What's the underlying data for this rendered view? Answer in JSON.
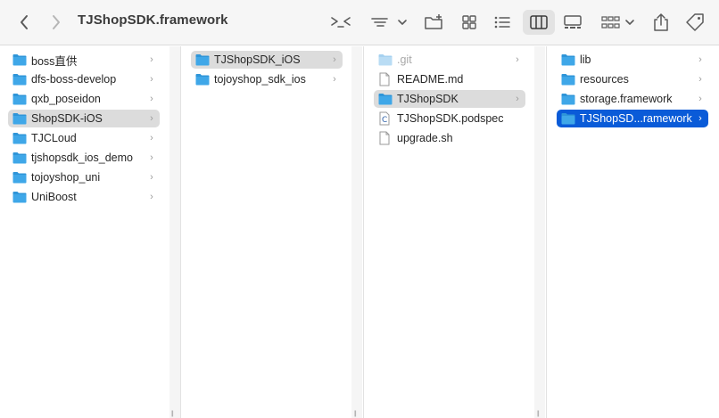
{
  "window": {
    "title": "TJShopSDK.framework",
    "accent_color": "#0a5bd8",
    "folder_color": "#3fa7e8"
  },
  "toolbar": {
    "back_icon": "chevron-left-icon",
    "forward_icon": "chevron-right-icon",
    "terminal_icon": "terminal-icon",
    "group_icon": "group-list-icon",
    "new_folder_icon": "new-folder-icon",
    "view_modes": [
      "icon-view-icon",
      "list-view-icon",
      "column-view-icon",
      "gallery-view-icon"
    ],
    "selected_view": "column-view-icon",
    "group_by_icon": "group-grid-icon",
    "share_icon": "share-icon",
    "tag_icon": "tag-icon"
  },
  "columns": [
    {
      "items": [
        {
          "label": "boss直供",
          "type": "folder",
          "has_children": true,
          "state": "normal"
        },
        {
          "label": "dfs-boss-develop",
          "type": "folder",
          "has_children": true,
          "state": "normal"
        },
        {
          "label": "qxb_poseidon",
          "type": "folder",
          "has_children": true,
          "state": "normal"
        },
        {
          "label": "ShopSDK-iOS",
          "type": "folder",
          "has_children": true,
          "state": "selected-inactive"
        },
        {
          "label": "TJCLoud",
          "type": "folder",
          "has_children": true,
          "state": "normal"
        },
        {
          "label": "tjshopsdk_ios_demo",
          "type": "folder",
          "has_children": true,
          "state": "normal"
        },
        {
          "label": "tojoyshop_uni",
          "type": "folder",
          "has_children": true,
          "state": "normal"
        },
        {
          "label": "UniBoost",
          "type": "folder",
          "has_children": true,
          "state": "normal"
        }
      ]
    },
    {
      "items": [
        {
          "label": "TJShopSDK_iOS",
          "type": "folder",
          "has_children": true,
          "state": "selected-inactive"
        },
        {
          "label": "tojoyshop_sdk_ios",
          "type": "folder",
          "has_children": true,
          "state": "normal"
        }
      ]
    },
    {
      "items": [
        {
          "label": ".git",
          "type": "folder-dim",
          "has_children": true,
          "state": "dim"
        },
        {
          "label": "README.md",
          "type": "doc",
          "has_children": false,
          "state": "normal"
        },
        {
          "label": "TJShopSDK",
          "type": "folder",
          "has_children": true,
          "state": "selected-inactive"
        },
        {
          "label": "TJShopSDK.podspec",
          "type": "podspec",
          "has_children": false,
          "state": "normal"
        },
        {
          "label": "upgrade.sh",
          "type": "doc",
          "has_children": false,
          "state": "normal"
        }
      ]
    },
    {
      "items": [
        {
          "label": "lib",
          "type": "folder",
          "has_children": true,
          "state": "normal"
        },
        {
          "label": "resources",
          "type": "folder",
          "has_children": true,
          "state": "normal"
        },
        {
          "label": "storage.framework",
          "type": "folder",
          "has_children": true,
          "state": "normal"
        },
        {
          "label": "TJShopSD...ramework",
          "type": "folder",
          "has_children": true,
          "state": "selected-active"
        }
      ]
    }
  ]
}
